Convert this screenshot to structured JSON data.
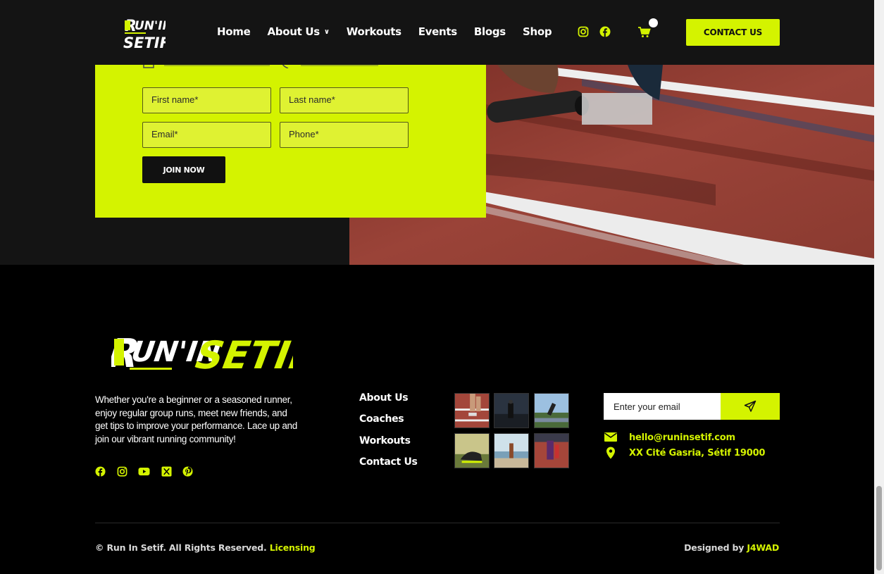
{
  "header": {
    "logo_text": "Run'In Setif",
    "nav": [
      {
        "label": "Home"
      },
      {
        "label": "About Us"
      },
      {
        "label": "Workouts"
      },
      {
        "label": "Events"
      },
      {
        "label": "Blogs"
      },
      {
        "label": "Shop"
      }
    ],
    "contact_button": "CONTACT US"
  },
  "join_form": {
    "first_name_placeholder": "First name*",
    "last_name_placeholder": "Last name*",
    "email_placeholder": "Email*",
    "phone_placeholder": "Phone*",
    "submit_label": "JOIN NOW"
  },
  "footer": {
    "logo_text": "Run'In Setif",
    "about": "Whether you're a beginner or a seasoned runner, enjoy regular group runs, meet new friends, and get tips to improve your performance. Lace up and join our vibrant running community!",
    "links": [
      {
        "label": "About Us"
      },
      {
        "label": "Coaches"
      },
      {
        "label": "Workouts"
      },
      {
        "label": "Contact Us"
      }
    ],
    "newsletter_placeholder": "Enter your email",
    "email": "hello@runinsetif.com",
    "address": "XX Cité Gasria, Sétif 19000",
    "copyright": "© Run In Setif. All Rights Reserved.",
    "licensing": "Licensing",
    "designed_by_label": "Designed by",
    "designer": "J4WAD"
  },
  "colors": {
    "accent": "#d4f300",
    "dark": "#141414",
    "black": "#000000",
    "track": "#8e3a30"
  },
  "icons": [
    "instagram-icon",
    "facebook-icon",
    "cart-icon",
    "youtube-icon",
    "x-icon",
    "pinterest-icon",
    "send-icon",
    "mail-icon",
    "location-pin-icon"
  ]
}
